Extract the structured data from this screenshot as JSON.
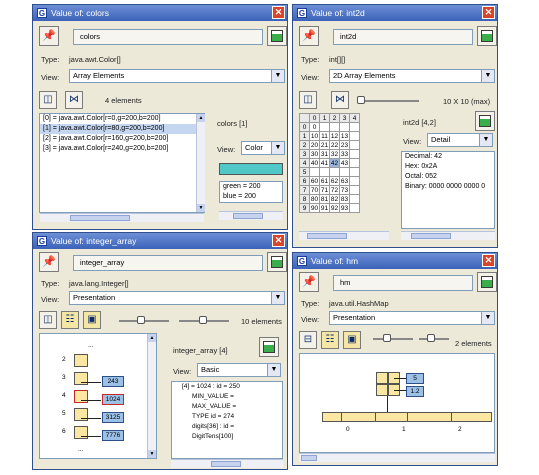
{
  "win_colors": {
    "title": "Value of: colors",
    "name": "colors",
    "type_label": "Type:",
    "type": "java.awt.Color[]",
    "view_label": "View:",
    "view": "Array Elements",
    "count": "4 elements",
    "items": [
      "[0] = java.awt.Color[r=0,g=200,b=200]",
      "[1] = java.awt.Color[r=80,g=200,b=200]",
      "[2] = java.awt.Color[r=160,g=200,b=200]",
      "[3] = java.awt.Color[r=240,g=200,b=200]"
    ],
    "selected_index": 1,
    "detail_title": "colors [1]",
    "detail_view": "Color",
    "green": "green = 200",
    "blue": "blue = 200",
    "swatch": "#50c8c8"
  },
  "win_int2d": {
    "title": "Value of: int2d",
    "name": "int2d",
    "type_label": "Type:",
    "type": "int[][]",
    "view_label": "View:",
    "view": "2D Array Elements",
    "size": "10 X 10 (max)",
    "col_headers": [
      "0",
      "1",
      "2",
      "3",
      "4"
    ],
    "rows": [
      [
        "0",
        "",
        "",
        "",
        ""
      ],
      [
        "1",
        "10",
        "11",
        "12",
        "13"
      ],
      [
        "2",
        "20",
        "21",
        "22",
        "23"
      ],
      [
        "3",
        "30",
        "31",
        "32",
        "33"
      ],
      [
        "4",
        "40",
        "41",
        "42",
        "43"
      ],
      [
        "5",
        "",
        "",
        "",
        ""
      ],
      [
        "6",
        "60",
        "61",
        "62",
        "63"
      ],
      [
        "7",
        "70",
        "71",
        "72",
        "73"
      ],
      [
        "8",
        "80",
        "81",
        "82",
        "83"
      ],
      [
        "9",
        "90",
        "91",
        "92",
        "93"
      ]
    ],
    "row_headers": [
      "0",
      "1",
      "2",
      "3",
      "4",
      "5",
      "6",
      "7",
      "8",
      "9"
    ],
    "detail_title": "int2d [4,2]",
    "detail_view": "Detail",
    "decimal": "Decimal: 42",
    "hex": "Hex: 0x2A",
    "octal": "Octal: 052",
    "binary": "Binary: 0000 0000 0000 0"
  },
  "win_integer": {
    "title": "Value of: integer_array",
    "name": "integer_array",
    "type_label": "Type:",
    "type": "java.lang.Integer[]",
    "view_label": "View:",
    "view": "Presentation",
    "count": "10 elements",
    "indices": [
      "2",
      "3",
      "4",
      "5",
      "6"
    ],
    "values": [
      "243",
      "1024",
      "3125",
      "7776"
    ],
    "top_label": "...",
    "bottom_label": "...",
    "detail_title": "integer_array [4]",
    "detail_view": "Basic",
    "tree": [
      "[4] = 1024 : id = 250",
      "MIN_VALUE =",
      "MAX_VALUE =",
      "TYPE id = 274",
      "digits[36] : id =",
      "DigitTens[100]"
    ]
  },
  "win_hm": {
    "title": "Value of: hm",
    "name": "hm",
    "type_label": "Type:",
    "type": "java.util.HashMap",
    "view_label": "View:",
    "view": "Presentation",
    "count": "2 elements",
    "node_values": [
      "5",
      "1.2"
    ],
    "table_labels": [
      "0",
      "1",
      "2"
    ]
  }
}
